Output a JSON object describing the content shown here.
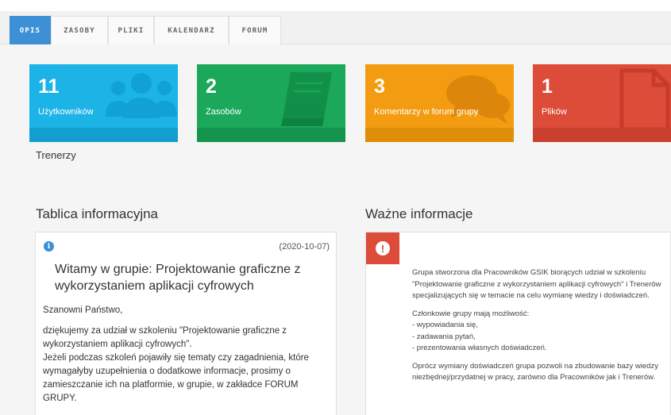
{
  "tabs": [
    {
      "label": "OPIS",
      "active": true
    },
    {
      "label": "ZASOBY",
      "active": false
    },
    {
      "label": "PLIKI",
      "active": false
    },
    {
      "label": "KALENDARZ",
      "active": false
    },
    {
      "label": "FORUM",
      "active": false
    }
  ],
  "stats": [
    {
      "number": "11",
      "label": "Użytkowników",
      "color": "#1cb3e6",
      "strip": "#129fcf",
      "icon": "users-icon"
    },
    {
      "number": "2",
      "label": "Zasobów",
      "color": "#1ba85a",
      "strip": "#14944d",
      "icon": "book-icon"
    },
    {
      "number": "3",
      "label": "Komentarzy w forum grupy",
      "color": "#f39c11",
      "strip": "#e08d0a",
      "icon": "comments-icon"
    },
    {
      "number": "1",
      "label": "Plików",
      "color": "#dd4b39",
      "strip": "#c9402f",
      "icon": "file-icon"
    }
  ],
  "group_name": "Trenerzy",
  "board": {
    "heading": "Tablica informacyjna",
    "date": "(2020-10-07)",
    "title": "Witamy w grupie: Projektowanie graficzne z wykorzystaniem aplikacji cyfrowych",
    "paragraphs": [
      "Szanowni Państwo,",
      "dziękujemy za udział w szkoleniu \"Projektowanie graficzne z wykorzystaniem aplikacji cyfrowych\".",
      "Jeżeli podczas szkoleń pojawiły się tematy czy zagadnienia, które wymagałyby uzupełnienia o dodatkowe informacje, prosimy o zamieszczanie ich na platformie, w grupie, w zakładce FORUM GRUPY."
    ]
  },
  "important": {
    "heading": "Ważne informacje",
    "p1": "Grupa stworzona dla Pracowników GSIK biorących udział w szkoleniu \"Projektowanie graficzne z wykorzystaniem aplikacji cyfrowych\" i Trenerów specjalizujących się w temacie na celu wymianę wiedzy i doświadczeń.",
    "p2_intro": "Członkowie grupy mają możliwość:",
    "list": [
      "- wypowiadania się,",
      "- zadawania pytań,",
      "- prezentowania własnych doświadczeń."
    ],
    "p3": "Oprócz wymiany doświadczeń grupa pozwoli na zbudowanie bazy wiedzy niezbędnej/przydatnej w pracy, zarówno dla Pracowników jak i Trenerów."
  }
}
